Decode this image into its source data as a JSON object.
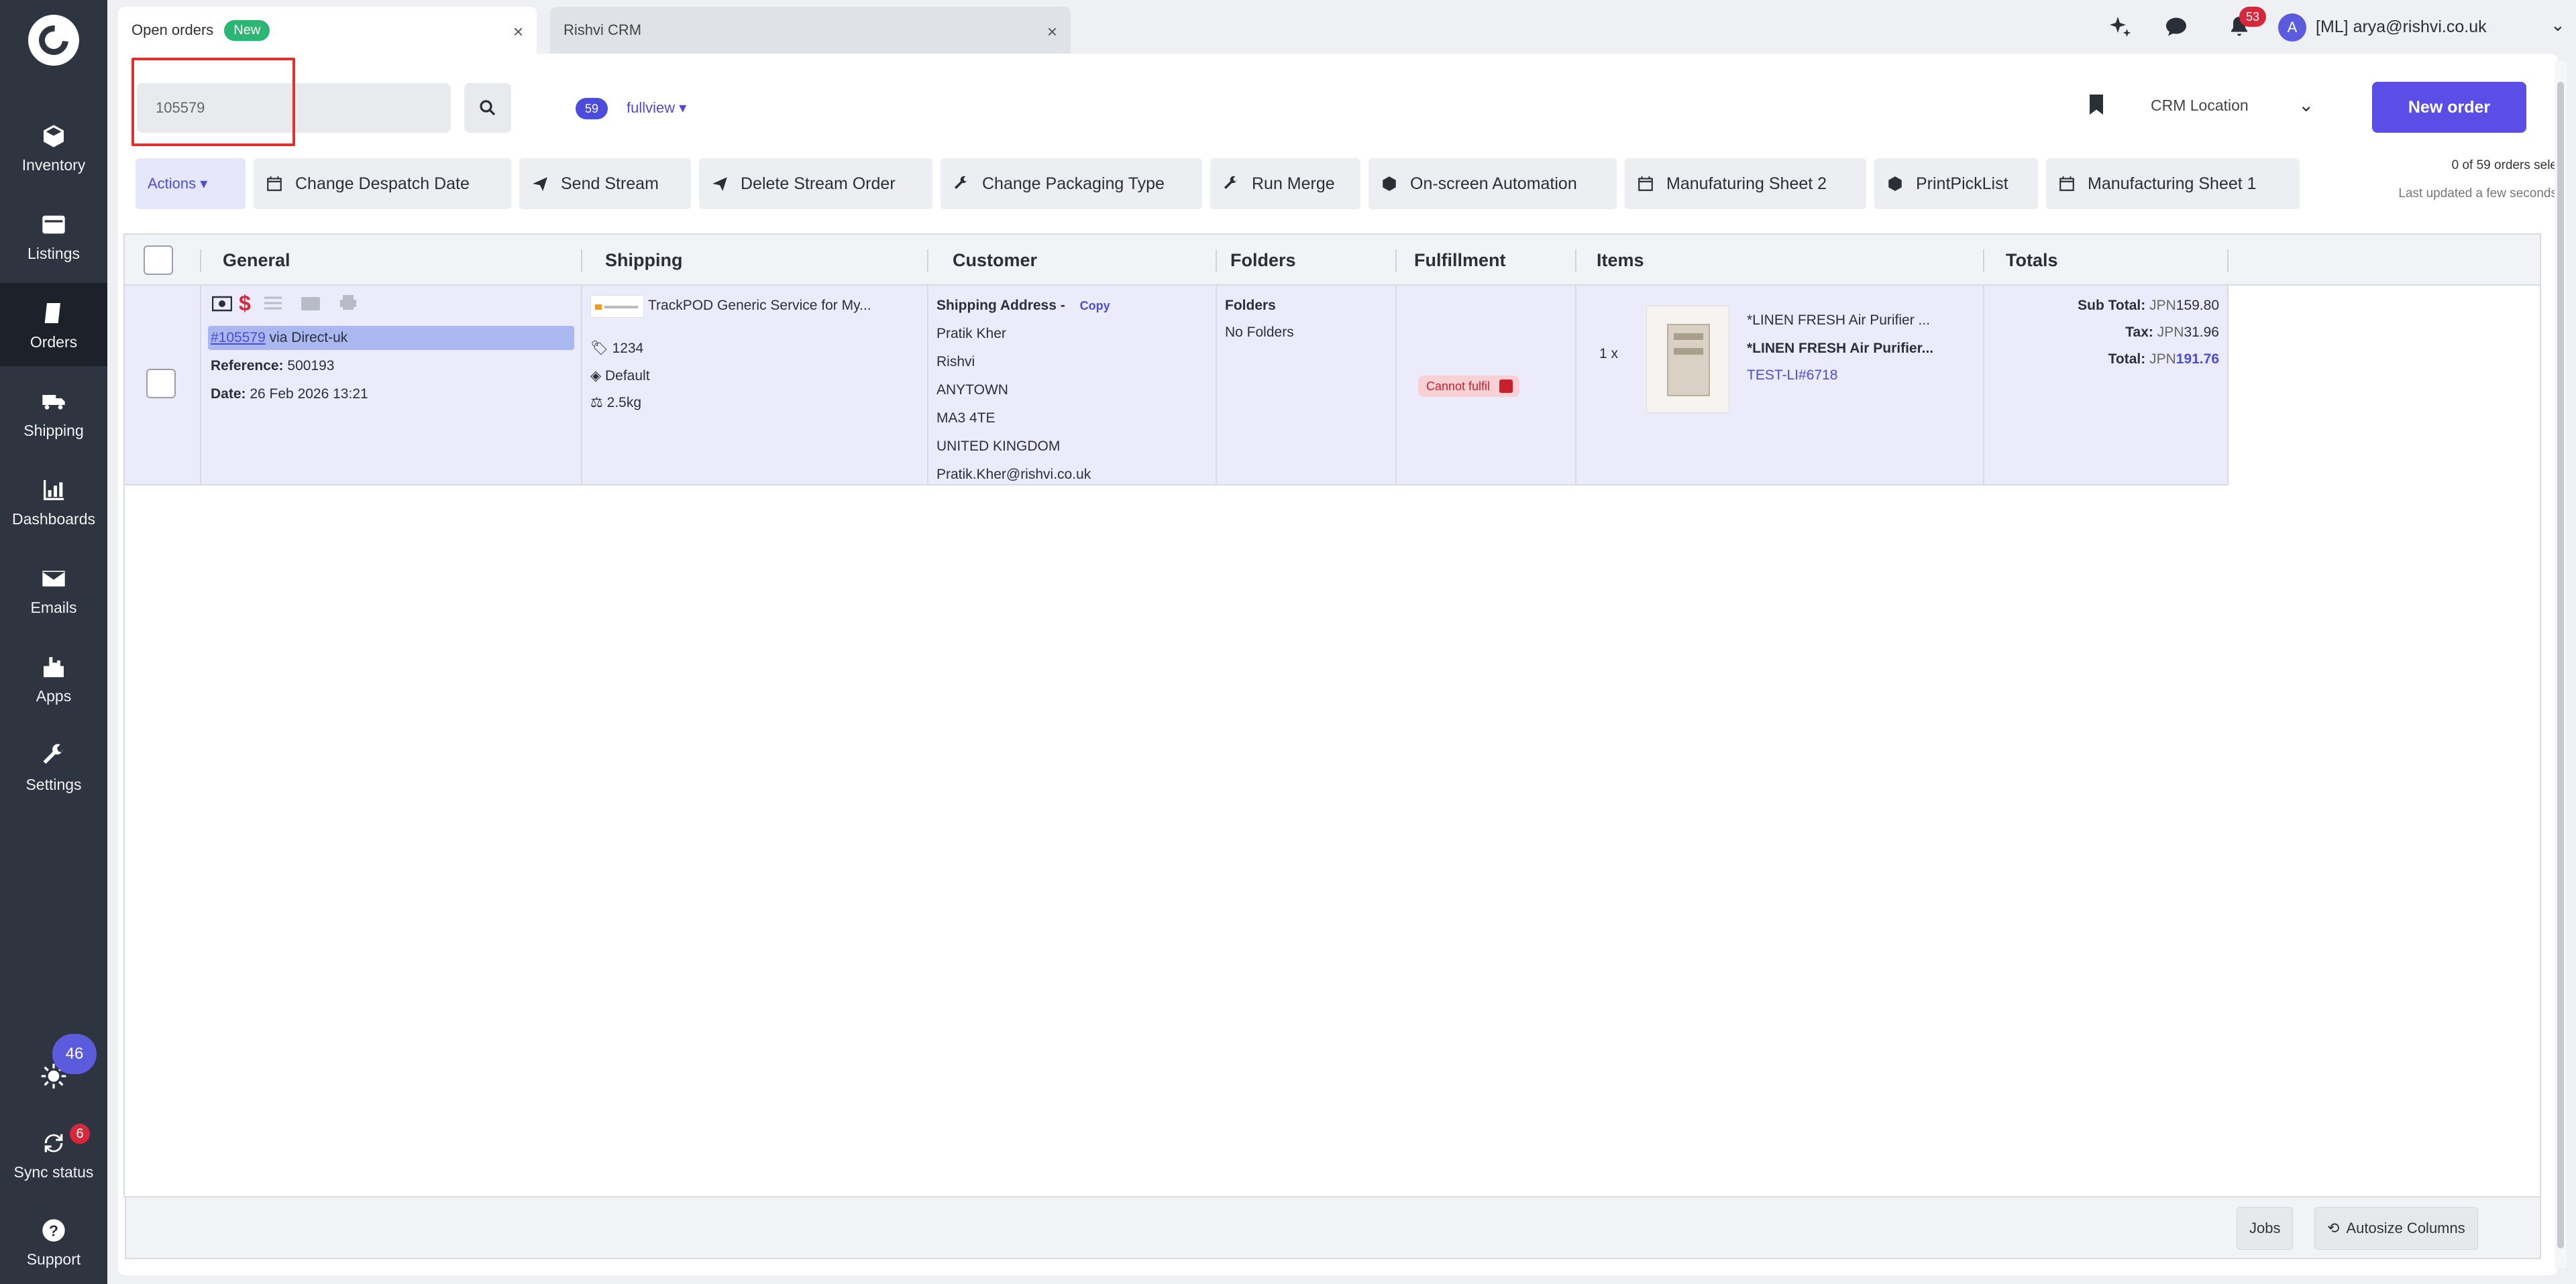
{
  "sidebar": {
    "items": [
      {
        "label": "Inventory",
        "icon": "inventory-icon"
      },
      {
        "label": "Listings",
        "icon": "listings-icon"
      },
      {
        "label": "Orders",
        "icon": "orders-icon"
      },
      {
        "label": "Shipping",
        "icon": "truck-icon"
      },
      {
        "label": "Dashboards",
        "icon": "chart-icon"
      },
      {
        "label": "Emails",
        "icon": "envelope-icon"
      },
      {
        "label": "Apps",
        "icon": "apps-icon"
      },
      {
        "label": "Settings",
        "icon": "wrench-icon"
      }
    ],
    "notifications_count": "46",
    "sync_status": {
      "label": "Sync status",
      "badge": "6"
    },
    "support_label": "Support"
  },
  "tabs": [
    {
      "label": "Open orders",
      "badge": "New"
    },
    {
      "label": "Rishvi CRM"
    }
  ],
  "topbar": {
    "notification_badge": "53",
    "avatar_letter": "A",
    "user_label": "[ML] arya@rishvi.co.uk"
  },
  "search": {
    "value": "105579"
  },
  "view": {
    "count": "59",
    "name": "fullview ▾"
  },
  "location": {
    "label": "CRM Location"
  },
  "new_order_label": "New order",
  "toolbar": [
    {
      "label": "Actions ▾",
      "icon": ""
    },
    {
      "label": "Change Despatch Date",
      "icon": "calendar-icon"
    },
    {
      "label": "Send Stream",
      "icon": "send-icon"
    },
    {
      "label": "Delete Stream Order",
      "icon": "send-icon"
    },
    {
      "label": "Change Packaging Type",
      "icon": "wrench-icon"
    },
    {
      "label": "Run Merge",
      "icon": "wrench-icon"
    },
    {
      "label": "On-screen Automation",
      "icon": "box-icon"
    },
    {
      "label": "Manufaturing Sheet 2",
      "icon": "calendar-icon"
    },
    {
      "label": "PrintPickList",
      "icon": "box-icon"
    },
    {
      "label": "Manufacturing Sheet 1",
      "icon": "calendar-icon"
    }
  ],
  "selection_status": "0 of 59 orders sele",
  "last_updated": "Last updated a few seconds",
  "columns": [
    "General",
    "Shipping",
    "Customer",
    "Folders",
    "Fulfillment",
    "Items",
    "Totals"
  ],
  "order": {
    "general": {
      "ref_link": "#105579",
      "via": " via Direct-uk",
      "reference_label": "Reference:",
      "reference_value": "500193",
      "date_label": "Date:",
      "date_value": "26 Feb 2026 13:21",
      "currency_symbol": "$"
    },
    "shipping": {
      "service": "TrackPOD Generic Service for My...",
      "tracking": "1234",
      "packaging": "Default",
      "weight": "2.5kg"
    },
    "customer": {
      "heading": "Shipping Address -",
      "copy_label": "Copy",
      "lines": [
        "Pratik Kher",
        "Rishvi",
        "ANYTOWN",
        "MA3 4TE",
        "UNITED KINGDOM",
        "Pratik.Kher@rishvi.co.uk"
      ]
    },
    "folders": {
      "heading": "Folders",
      "value": "No Folders"
    },
    "fulfillment": {
      "status": "Cannot fulfil"
    },
    "items": {
      "qty": "1 x",
      "title_1": "*LINEN FRESH Air Purifier ...",
      "title_2": "*LINEN FRESH Air Purifier...",
      "sku": "TEST-LI#6718"
    },
    "totals": {
      "subtotal_label": "Sub Total:",
      "subtotal_currency": "JPN",
      "subtotal_value": "159.80",
      "tax_label": "Tax:",
      "tax_currency": "JPN",
      "tax_value": "31.96",
      "total_label": "Total:",
      "total_currency": "JPN",
      "total_value": "191.76"
    }
  },
  "footer": {
    "jobs_label": "Jobs",
    "autosize_label": "Autosize Columns"
  },
  "colors": {
    "accent": "#5b4ee6",
    "sidebar": "#2e3440",
    "row_selected": "#ecebfb",
    "danger": "#d6283a"
  }
}
